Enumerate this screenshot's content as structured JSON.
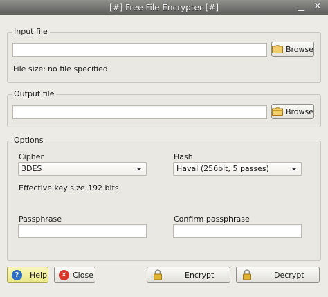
{
  "window": {
    "title": "[#] Free File Encrypter [#]",
    "close_glyph": "✕"
  },
  "input_group": {
    "legend": "Input file",
    "path_value": "",
    "browse_label": "Browse",
    "filesize_label": "File size:",
    "filesize_value": "no file specified"
  },
  "output_group": {
    "legend": "Output file",
    "path_value": "",
    "browse_label": "Browse"
  },
  "options_group": {
    "legend": "Options",
    "cipher_label": "Cipher",
    "cipher_value": "3DES",
    "hash_label": "Hash",
    "hash_value": "Haval (256bit, 5 passes)",
    "keysize_label": "Effective key size:",
    "keysize_value": "192 bits",
    "passphrase_label": "Passphrase",
    "confirm_label": "Confirm passphrase"
  },
  "buttons": {
    "help": "Help",
    "close": "Close",
    "encrypt": "Encrypt",
    "decrypt": "Decrypt"
  },
  "icons": {
    "help": "help-question-icon",
    "close": "close-x-icon",
    "browse": "folder-icon",
    "lock": "lock-icon"
  },
  "colors": {
    "help_bg": "#f3f1a6",
    "close_red": "#d9342b",
    "help_blue": "#2e6fc3"
  }
}
